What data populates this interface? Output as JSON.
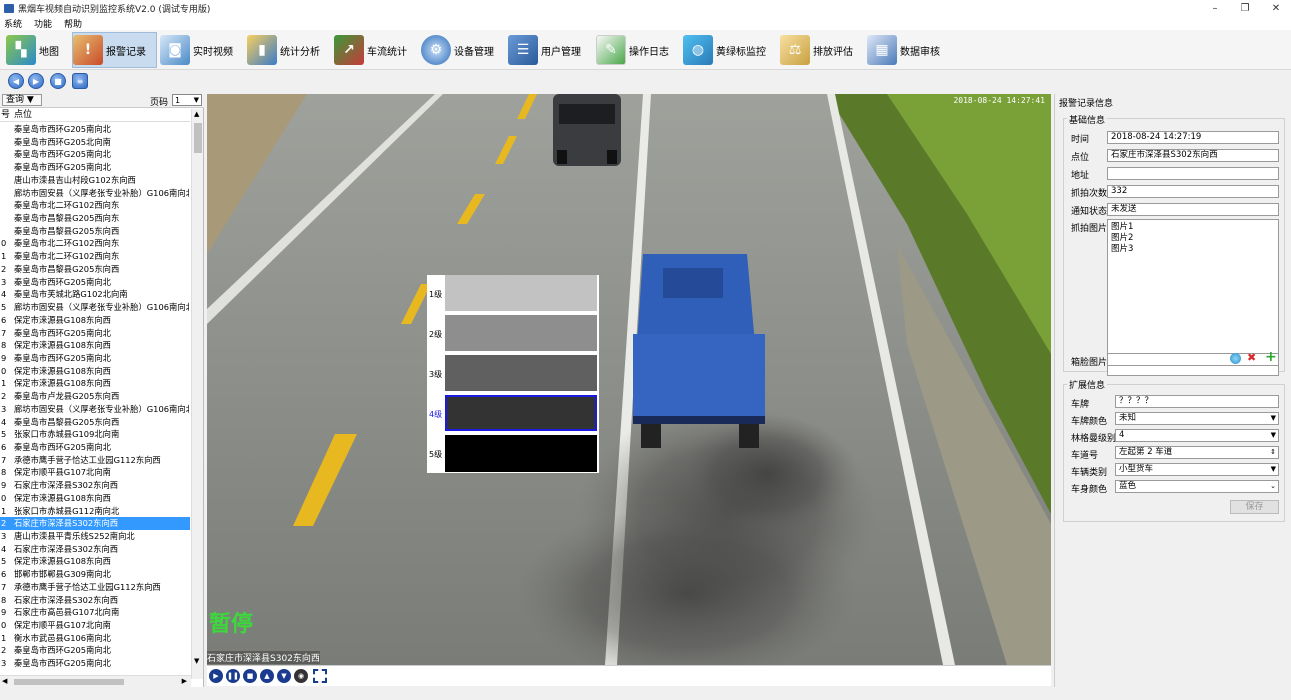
{
  "window": {
    "title": "黑烟车视频自动识别监控系统V2.0 (调试专用版)",
    "minimize": "–",
    "maximize": "❐",
    "close": "✕"
  },
  "menu": [
    "系统",
    "功能",
    "帮助"
  ],
  "toolbar": [
    {
      "label": "地图",
      "icon": "map-icon",
      "color": "#3a9a3a"
    },
    {
      "label": "报警记录",
      "icon": "alarm-record-icon",
      "color": "#c84a2a"
    },
    {
      "label": "实时视频",
      "icon": "camera-icon",
      "color": "#4a8ac8"
    },
    {
      "label": "统计分析",
      "icon": "bar-chart-icon",
      "color": "#e0a020"
    },
    {
      "label": "车流统计",
      "icon": "traffic-chart-icon",
      "color": "#2a7ac8"
    },
    {
      "label": "设备管理",
      "icon": "gear-icon",
      "color": "#2a6ab8"
    },
    {
      "label": "用户管理",
      "icon": "user-icon",
      "color": "#3a78b8"
    },
    {
      "label": "操作日志",
      "icon": "pen-icon",
      "color": "#4aa84a"
    },
    {
      "label": "黄绿标监控",
      "icon": "globe-icon",
      "color": "#2a9ad8"
    },
    {
      "label": "排放评估",
      "icon": "scale-icon",
      "color": "#c8a040"
    },
    {
      "label": "数据审核",
      "icon": "audit-icon",
      "color": "#4a7ab8"
    }
  ],
  "nav_buttons": [
    "prev-icon",
    "next-icon",
    "stop-icon",
    "refresh-icon"
  ],
  "list_panel": {
    "query_label": "查询 ▼",
    "page_label": "页码",
    "page_value": "1",
    "col_num": "号",
    "col_location": "点位",
    "selected_index": 31,
    "rows": [
      {
        "n": "",
        "t": "秦皇岛市西环G205南向北"
      },
      {
        "n": "",
        "t": "秦皇岛市西环G205北向南"
      },
      {
        "n": "",
        "t": "秦皇岛市西环G205南向北"
      },
      {
        "n": "",
        "t": "秦皇岛市西环G205南向北"
      },
      {
        "n": "",
        "t": "唐山市滦县吉山村段G102东向西"
      },
      {
        "n": "",
        "t": "廊坊市固安县（义厚老张专业补胎）G106南向北"
      },
      {
        "n": "",
        "t": "秦皇岛市北二环G102西向东"
      },
      {
        "n": "",
        "t": "秦皇岛市昌黎县G205西向东"
      },
      {
        "n": "",
        "t": "秦皇岛市昌黎县G205东向西"
      },
      {
        "n": "0",
        "t": "秦皇岛市北二环G102西向东"
      },
      {
        "n": "1",
        "t": "秦皇岛市北二环G102西向东"
      },
      {
        "n": "2",
        "t": "秦皇岛市昌黎县G205东向西"
      },
      {
        "n": "3",
        "t": "秦皇岛市西环G205南向北"
      },
      {
        "n": "4",
        "t": "秦皇岛市芙城北路G102北向南"
      },
      {
        "n": "5",
        "t": "廊坊市固安县（义厚老张专业补胎）G106南向北"
      },
      {
        "n": "6",
        "t": "保定市涞源县G108东向西"
      },
      {
        "n": "7",
        "t": "秦皇岛市西环G205南向北"
      },
      {
        "n": "8",
        "t": "保定市涞源县G108东向西"
      },
      {
        "n": "9",
        "t": "秦皇岛市西环G205南向北"
      },
      {
        "n": "0",
        "t": "保定市涞源县G108东向西"
      },
      {
        "n": "1",
        "t": "保定市涞源县G108东向西"
      },
      {
        "n": "2",
        "t": "秦皇岛市卢龙县G205东向西"
      },
      {
        "n": "3",
        "t": "廊坊市固安县（义厚老张专业补胎）G106南向北"
      },
      {
        "n": "4",
        "t": "秦皇岛市昌黎县G205东向西"
      },
      {
        "n": "5",
        "t": "张家口市赤城县G109北向南"
      },
      {
        "n": "6",
        "t": "秦皇岛市西环G205南向北"
      },
      {
        "n": "7",
        "t": "承德市鹰手营子恰达工业园G112东向西"
      },
      {
        "n": "8",
        "t": "保定市顺平县G107北向南"
      },
      {
        "n": "9",
        "t": "石家庄市深泽县S302东向西"
      },
      {
        "n": "0",
        "t": "保定市涞源县G108东向西"
      },
      {
        "n": "1",
        "t": "张家口市赤城县G112南向北"
      },
      {
        "n": "2",
        "t": "石家庄市深泽县S302东向西"
      },
      {
        "n": "3",
        "t": "唐山市滦县平青乐线S252南向北"
      },
      {
        "n": "4",
        "t": "石家庄市深泽县S302东向西"
      },
      {
        "n": "5",
        "t": "保定市涞源县G108东向西"
      },
      {
        "n": "6",
        "t": "邯郸市邯郸县G309南向北"
      },
      {
        "n": "7",
        "t": "承德市鹰手营子恰达工业园G112东向西"
      },
      {
        "n": "8",
        "t": "石家庄市深泽县S302东向西"
      },
      {
        "n": "9",
        "t": "石家庄市高邑县G107北向南"
      },
      {
        "n": "0",
        "t": "保定市顺平县G107北向南"
      },
      {
        "n": "1",
        "t": "衡水市武邑县G106南向北"
      },
      {
        "n": "2",
        "t": "秦皇岛市西环G205南向北"
      },
      {
        "n": "3",
        "t": "秦皇岛市西环G205南向北"
      }
    ]
  },
  "video": {
    "timestamp": "2018-08-24 14:27:41",
    "paused_text": "暂停",
    "location_overlay": "石家庄市深泽县S302东向西",
    "opacity_labels": [
      "1级",
      "2级",
      "3级",
      "4级",
      "5级"
    ],
    "selected_level": 4,
    "controls": [
      "play-icon",
      "pause-icon",
      "stop-icon",
      "eject-icon",
      "down-icon",
      "snapshot-icon",
      "fullscreen-icon"
    ]
  },
  "record_panel": {
    "title": "报警记录信息",
    "basic_title": "基础信息",
    "time_label": "时间",
    "time_value": "2018-08-24 14:27:19",
    "location_label": "点位",
    "location_value": "石家庄市深泽县S302东向西",
    "address_label": "地址",
    "address_value": "",
    "capture_count_label": "抓拍次数",
    "capture_count_value": "332",
    "notify_label": "通知状态",
    "notify_value": "未发送",
    "capture_pics_label": "抓拍图片",
    "capture_pics": [
      "图片1",
      "图片2",
      "图片3"
    ],
    "plate_pic_label": "箱脸图片",
    "plate_pic_value": "",
    "ext_title": "扩展信息",
    "plate_label": "车牌",
    "plate_value": "？？？？",
    "plate_color_label": "车牌颜色",
    "plate_color_value": "未知",
    "ringelmann_label": "林格曼级别",
    "ringelmann_value": "4",
    "lane_label": "车道号",
    "lane_value": "左起第 2 车道",
    "vehicle_type_label": "车辆类别",
    "vehicle_type_value": "小型货车",
    "body_color_label": "车身颜色",
    "body_color_value": "蓝色",
    "save_label": "保存"
  }
}
